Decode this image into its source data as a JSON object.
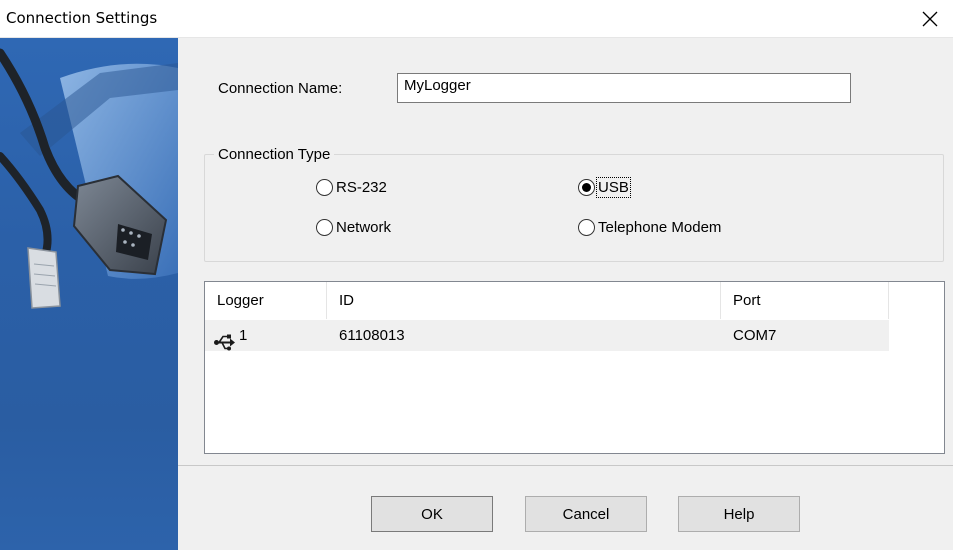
{
  "window": {
    "title": "Connection Settings",
    "close_icon": "close-icon"
  },
  "form": {
    "connection_name_label": "Connection Name:",
    "connection_name_value": "MyLogger",
    "connection_type_legend": "Connection Type",
    "options": [
      {
        "label": "RS-232",
        "checked": false
      },
      {
        "label": "USB",
        "checked": true
      },
      {
        "label": "Network",
        "checked": false
      },
      {
        "label": "Telephone Modem",
        "checked": false
      }
    ]
  },
  "logger_list": {
    "columns": [
      "Logger",
      "ID",
      "Port"
    ],
    "rows": [
      {
        "icon": "usb-icon",
        "logger": "1",
        "id": "61108013",
        "port": "COM7"
      }
    ]
  },
  "buttons": {
    "ok": "OK",
    "cancel": "Cancel",
    "help": "Help"
  },
  "colors": {
    "side_panel": "#2b60a8",
    "dialog_bg": "#f0f0f0",
    "row_bg": "#f0f0f0"
  }
}
